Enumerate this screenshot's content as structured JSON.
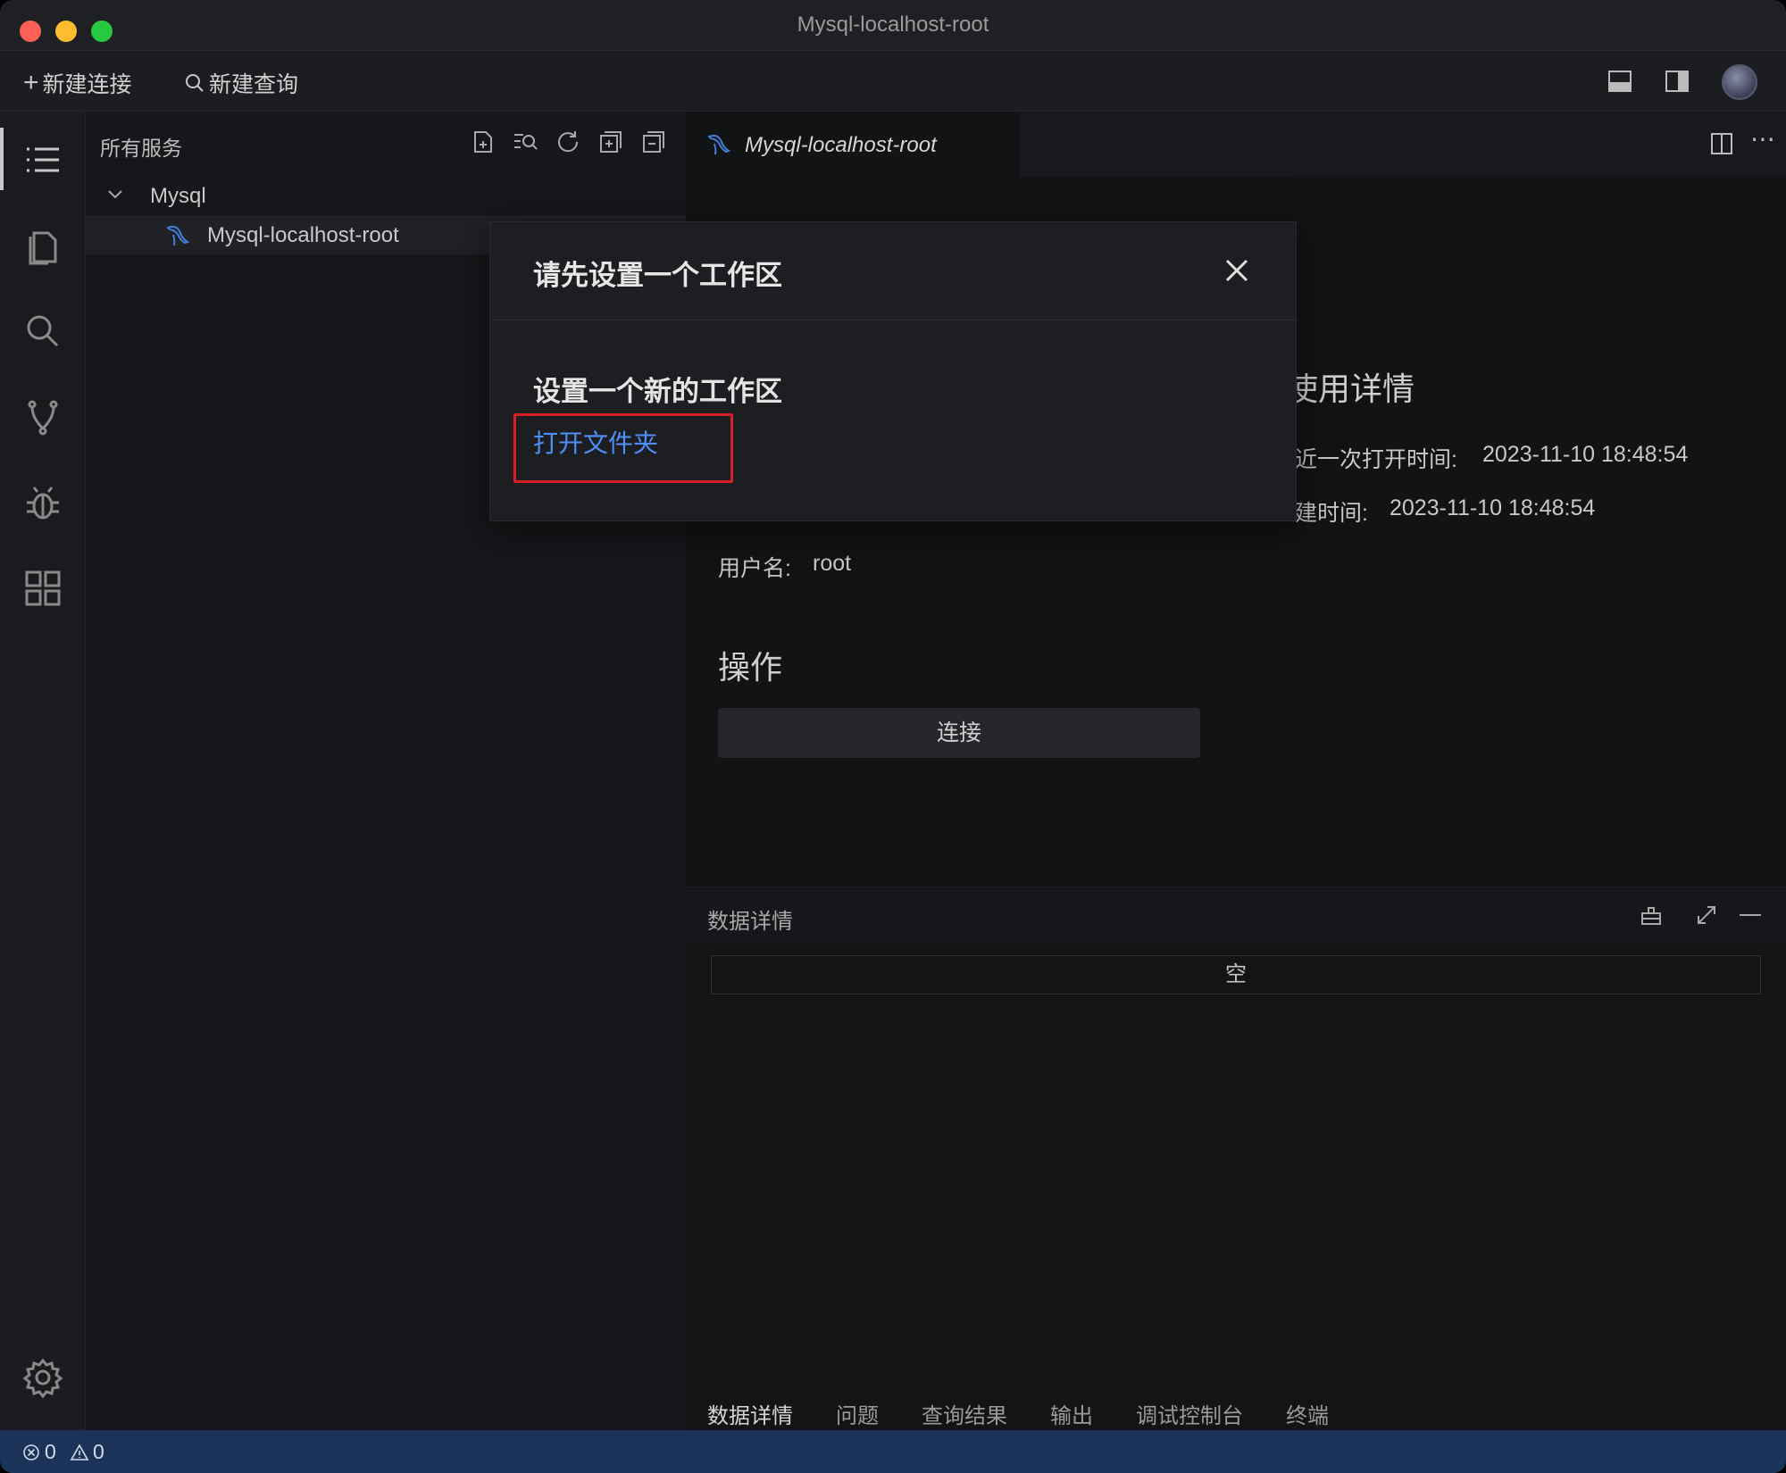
{
  "window": {
    "title": "Mysql-localhost-root"
  },
  "toolbar": {
    "new_connection": "新建连接",
    "new_query": "新建查询"
  },
  "sidebar": {
    "title": "所有服务",
    "group": "Mysql",
    "connection": "Mysql-localhost-root"
  },
  "editor": {
    "tab_label": "Mysql-localhost-root",
    "usage_heading_partial": "使用详情",
    "last_open_label": "近一次打开时间:",
    "last_open_value": "2023-11-10 18:48:54",
    "created_label": "建时间:",
    "created_value": "2023-11-10 18:48:54",
    "username_label": "用户名:",
    "username_value": "root",
    "actions_heading": "操作",
    "connect_button": "连接"
  },
  "panel": {
    "title": "数据详情",
    "empty_text": "空",
    "tabs": [
      "数据详情",
      "问题",
      "查询结果",
      "输出",
      "调试控制台",
      "终端"
    ]
  },
  "statusbar": {
    "errors": "0",
    "warnings": "0"
  },
  "dialog": {
    "title": "请先设置一个工作区",
    "subtitle": "设置一个新的工作区",
    "link": "打开文件夹"
  },
  "colors": {
    "accent_link": "#4d8ff7",
    "highlight": "#d81e28",
    "statusbar": "#1b3358"
  }
}
